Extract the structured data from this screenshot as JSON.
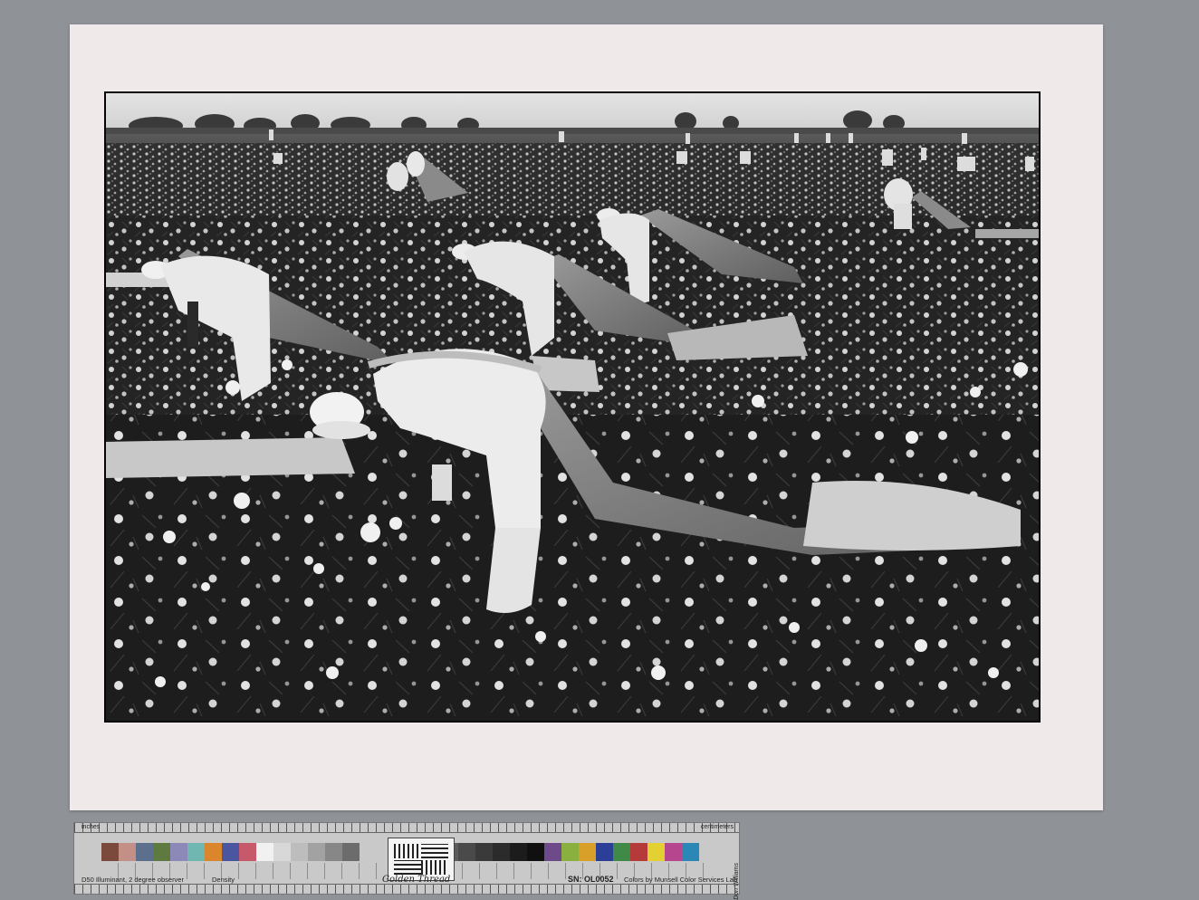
{
  "photo": {
    "subject": "black-and-white-photograph",
    "tone": "monochrome"
  },
  "color_target": {
    "ruler_label_left": "inches",
    "ruler_label_right": "centimeters",
    "illuminant_text": "D50 Illuminant, 2 degree observer",
    "density_label": "Density",
    "brand": "Golden Thread",
    "serial": "SN: OL0052",
    "credit": "Colors by Munsell Color Services Lab",
    "signature": "Don Williams",
    "patch_colors_left": [
      "#7b4a3c",
      "#c48f86",
      "#5c6f8c",
      "#5e7a3e",
      "#8c88b8",
      "#6fb7b0",
      "#d9862c",
      "#4a56a0",
      "#c65a6a",
      "#f1f1f1",
      "#d8d8d8",
      "#bdbdbd",
      "#a2a2a2",
      "#878787",
      "#6c6c6c"
    ],
    "patch_colors_right": [
      "#5c5c5c",
      "#4a4a4a",
      "#3a3a3a",
      "#2b2b2b",
      "#1c1c1c",
      "#101010",
      "#6f4a8a",
      "#8ab040",
      "#d8a028",
      "#2c3f96",
      "#3f8a48",
      "#b53a3a",
      "#e3d032",
      "#b6478f",
      "#2b88b6"
    ]
  }
}
